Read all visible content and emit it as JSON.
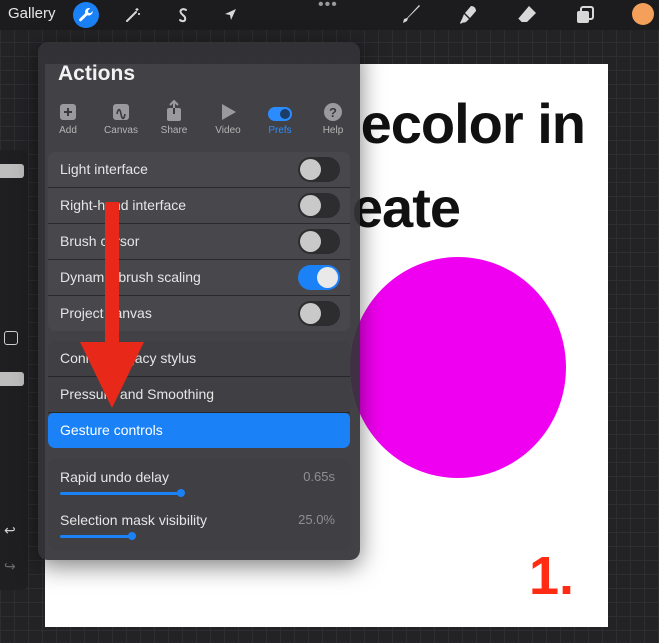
{
  "topbar": {
    "gallery_label": "Gallery",
    "more_label": "•••"
  },
  "canvas": {
    "title_line1": "ecolor in",
    "title_line2": "eate",
    "step_label": "1."
  },
  "panel": {
    "title": "Actions",
    "tabs": [
      {
        "label": "Add",
        "icon": "add-icon"
      },
      {
        "label": "Canvas",
        "icon": "canvas-icon"
      },
      {
        "label": "Share",
        "icon": "share-icon"
      },
      {
        "label": "Video",
        "icon": "video-icon"
      },
      {
        "label": "Prefs",
        "icon": "prefs-toggle-icon"
      },
      {
        "label": "Help",
        "icon": "help-icon"
      }
    ],
    "active_tab": "Prefs",
    "toggles": [
      {
        "label": "Light interface",
        "on": false
      },
      {
        "label": "Right-hand interface",
        "on": false
      },
      {
        "label": "Brush cursor",
        "on": false
      },
      {
        "label": "Dynamic brush scaling",
        "on": true
      },
      {
        "label": "Project canvas",
        "on": false
      }
    ],
    "links": [
      {
        "label": "Connect legacy stylus"
      },
      {
        "label": "Pressure and Smoothing"
      },
      {
        "label": "Gesture controls"
      }
    ],
    "sliders": [
      {
        "label": "Rapid undo delay",
        "value": "0.65s",
        "fraction": 0.45
      },
      {
        "label": "Selection mask visibility",
        "value": "25.0%",
        "fraction": 0.25
      }
    ]
  },
  "colors": {
    "accent": "#1a82f6",
    "arrow": "#e8291a",
    "current_color": "#f4a05a"
  }
}
